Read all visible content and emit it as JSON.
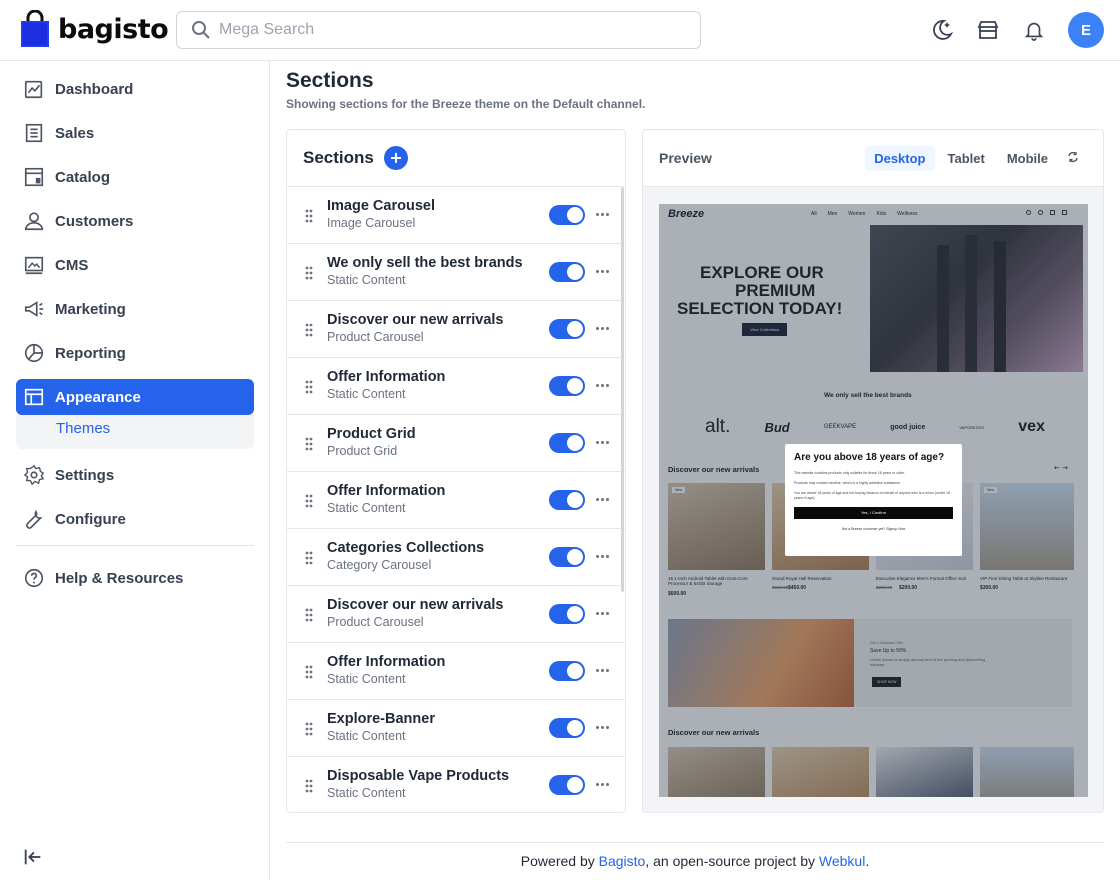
{
  "app": {
    "brand": "bagisto"
  },
  "search": {
    "placeholder": "Mega Search"
  },
  "user": {
    "initial": "E"
  },
  "sidebar": {
    "items": [
      {
        "label": "Dashboard"
      },
      {
        "label": "Sales"
      },
      {
        "label": "Catalog"
      },
      {
        "label": "Customers"
      },
      {
        "label": "CMS"
      },
      {
        "label": "Marketing"
      },
      {
        "label": "Reporting"
      },
      {
        "label": "Appearance"
      },
      {
        "label": "Settings"
      },
      {
        "label": "Configure"
      },
      {
        "label": "Help & Resources"
      }
    ],
    "sub_item": "Themes"
  },
  "page": {
    "title": "Sections",
    "subtitle": "Showing sections for the Breeze theme on the Default channel."
  },
  "sections_panel": {
    "title": "Sections",
    "rows": [
      {
        "title": "Image Carousel",
        "type": "Image Carousel"
      },
      {
        "title": "We only sell the best brands",
        "type": "Static Content"
      },
      {
        "title": "Discover our new arrivals",
        "type": "Product Carousel"
      },
      {
        "title": "Offer Information",
        "type": "Static Content"
      },
      {
        "title": "Product Grid",
        "type": "Product Grid"
      },
      {
        "title": "Offer Information",
        "type": "Static Content"
      },
      {
        "title": "Categories Collections",
        "type": "Category Carousel"
      },
      {
        "title": "Discover our new arrivals",
        "type": "Product Carousel"
      },
      {
        "title": "Offer Information",
        "type": "Static Content"
      },
      {
        "title": "Explore-Banner",
        "type": "Static Content"
      },
      {
        "title": "Disposable Vape Products",
        "type": "Static Content"
      }
    ]
  },
  "preview": {
    "title": "Preview",
    "tabs": [
      "Desktop",
      "Tablet",
      "Mobile"
    ],
    "active_tab": "Desktop",
    "store": {
      "logo": "Breeze",
      "nav": [
        "All",
        "Men",
        "Women",
        "Kids",
        "Wellness"
      ],
      "hero_line1": "EXPLORE OUR",
      "hero_line2": "PREMIUM",
      "hero_line3": "SELECTION TODAY!",
      "hero_button": "View Collections",
      "brands_heading": "We only sell the best brands",
      "brands": [
        "alt.",
        "Bud",
        "GEEKVAPE",
        "good juice",
        "VAPORESSO",
        "vex"
      ],
      "arrivals_heading": "Discover our new arrivals",
      "products": [
        {
          "name": "15.1-Inch Android Tablet with Octa-Core Processor & 64GB Storage",
          "price": "$600.00",
          "old_price": ""
        },
        {
          "name": "Grand Royal Hall Reservation",
          "price": "$450.00",
          "old_price": "$500.00"
        },
        {
          "name": "Executive Elegance Men's Formal Office Suit",
          "price": "$200.00",
          "old_price": "$250.00"
        },
        {
          "name": "VIP Fine Dining Table at Skyline Restaurant",
          "price": "$300.00",
          "old_price": ""
        }
      ],
      "badge": "New",
      "banner_kicker": "Get a Seasonal Offer",
      "banner_title": "Save Up to 50%",
      "banner_text": "Lorem Ipsum is simply dummy text of the printing and typesetting industry.",
      "banner_button": "SHOP NOW",
      "arrivals_heading_2": "Discover our new arrivals",
      "modal": {
        "title": "Are you above 18 years of age?",
        "line1": "This website contains products only suitable for those 18 years or older.",
        "line2": "Products may contain nicotine, which is a highly addictive substance.",
        "line3": "You are above 18 years of age and not buying tobacco on behalf of anyone who is a minor (under 18 years of age).",
        "confirm": "Yes, I Confirm",
        "footer": "Not a Breeze customer yet? Signup Now"
      }
    }
  },
  "footer": {
    "prefix": "Powered by ",
    "link1": "Bagisto",
    "middle": ", an open-source project by ",
    "link2": "Webkul",
    "suffix": "."
  },
  "colors": {
    "accent": "#2563eb",
    "avatar": "#3b82f6"
  }
}
